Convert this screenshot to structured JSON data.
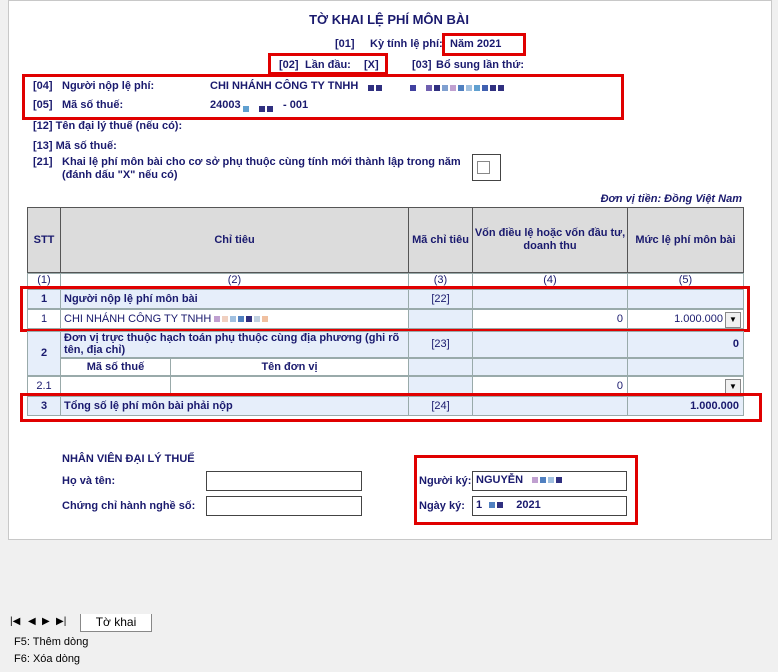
{
  "form": {
    "title": "TỜ KHAI LỆ PHÍ MÔN BÀI",
    "field01_code": "[01]",
    "field01_label": "Kỳ tính lệ phí:",
    "field01_value": "Năm 2021",
    "field02_code": "[02]",
    "field02_label": "Lần đầu:",
    "field02_value": "[X]",
    "field03_code": "[03]",
    "field03_label": "Bổ sung lần thứ:",
    "field04_code": "[04]",
    "field04_label": "Người nộp lệ phí:",
    "field04_value": "CHI NHÁNH CÔNG TY TNHH",
    "field05_code": "[05]",
    "field05_label": "Mã số thuế:",
    "field05_value_a": "24003",
    "field05_value_b": "- 001",
    "field12": "[12]  Tên đại lý thuế (nếu có):",
    "field13": "[13]  Mã số thuế:",
    "field21_code": "[21]",
    "field21_text": "Khai lệ phí môn bài cho cơ sở phụ thuộc cùng tính mới thành lập trong năm (đánh dấu \"X\" nếu có)",
    "currency": "Đơn vị tiền: Đồng Việt Nam"
  },
  "table": {
    "headers": [
      "STT",
      "Chỉ tiêu",
      "Mã chỉ tiêu",
      "Vốn điều lệ hoặc vốn đầu tư, doanh thu",
      "Mức lệ phí môn bài"
    ],
    "col_nums": [
      "(1)",
      "(2)",
      "(3)",
      "(4)",
      "(5)"
    ],
    "row1": {
      "stt": "1",
      "label": "Người nộp lệ phí môn bài",
      "code": "[22]"
    },
    "row1_1": {
      "stt": "1",
      "name": "CHI NHÁNH CÔNG TY TNHH",
      "capital": "0",
      "fee": "1.000.000"
    },
    "row2": {
      "stt": "2",
      "label": "Đơn vị trực thuộc hạch toán phụ thuộc cùng địa phương (ghi rõ tên, địa chỉ)",
      "code": "[23]",
      "fee": "0"
    },
    "row2_sub": {
      "col_a": "Mã số thuế",
      "col_b": "Tên đơn vị"
    },
    "row2_1": {
      "stt": "2.1",
      "capital": "0"
    },
    "row3": {
      "stt": "3",
      "label": "Tổng số lệ phí môn bài phải nộp",
      "code": "[24]",
      "fee": "1.000.000"
    }
  },
  "agent": {
    "title": "NHÂN VIÊN ĐẠI LÝ THUẾ",
    "name_label": "Họ và tên:",
    "cert_label": "Chứng chỉ hành nghề số:"
  },
  "signer": {
    "signer_label": "Người ký:",
    "signer_value": "NGUYỄN",
    "date_label": "Ngày ký:",
    "date_value_a": "1",
    "date_value_b": "2021"
  },
  "tabs": {
    "sheet": "Tờ khai"
  },
  "shortcuts": {
    "f5": "F5: Thêm dòng",
    "f6": "F6: Xóa dòng"
  }
}
